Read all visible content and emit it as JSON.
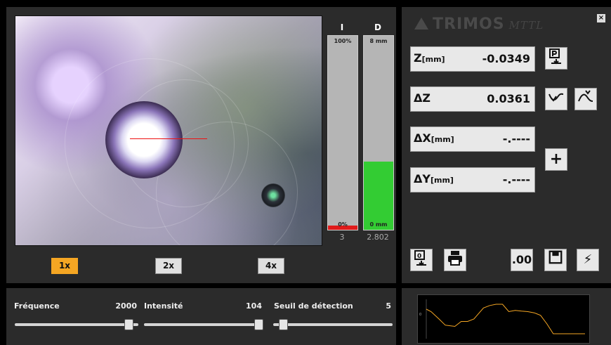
{
  "bars": {
    "intensity": {
      "label": "I",
      "top": "100%",
      "bottom": "0%",
      "value": "3",
      "fill_fraction": 0.02,
      "fill_color": "#e01b1b"
    },
    "distance": {
      "label": "D",
      "top": "8 mm",
      "bottom": "0 mm",
      "value": "2.802",
      "fill_fraction": 0.35,
      "fill_color": "#33cc33"
    }
  },
  "zoom": {
    "z1": "1x",
    "z2": "2x",
    "z4": "4x",
    "active": "1x",
    "active_color": "#f5a623"
  },
  "logo": {
    "name": "TRIMOS",
    "sub": "MTTL"
  },
  "close_label": "×",
  "fields": {
    "z": {
      "label": "Z",
      "unit": "[mm]",
      "value": "-0.0349"
    },
    "dz": {
      "label": "ΔZ",
      "value": "0.0361"
    },
    "dx": {
      "label": "ΔX",
      "unit": "[mm]",
      "value": "-.----"
    },
    "dy": {
      "label": "ΔY",
      "unit": "[mm]",
      "value": "-.----"
    }
  },
  "buttons": {
    "plus": "+",
    "zero": ".00",
    "flash": "⚡"
  },
  "sliders": {
    "frequency": {
      "label": "Fréquence",
      "value": "2000"
    },
    "intensity": {
      "label": "Intensité",
      "value": "104"
    },
    "threshold": {
      "label": "Seuil de détection",
      "value": "5"
    }
  },
  "chart_data": {
    "type": "line",
    "title": "",
    "xlabel": "",
    "ylabel": "",
    "ytick_labels": [
      "0"
    ],
    "series_color": "#f5a623",
    "x": [
      0,
      3,
      8,
      12,
      18,
      22,
      26,
      30,
      36,
      40,
      44,
      48,
      52,
      56,
      60,
      64,
      68,
      72,
      76,
      80,
      84,
      88,
      92,
      96,
      100
    ],
    "values": [
      0.2,
      0.1,
      -0.2,
      -0.45,
      -0.5,
      -0.3,
      -0.3,
      -0.2,
      0.25,
      0.35,
      0.4,
      0.4,
      0.1,
      0.15,
      0.12,
      0.1,
      0.05,
      -0.05,
      -0.4,
      -0.8,
      -0.8,
      -0.8,
      -0.8,
      -0.8,
      -0.8
    ]
  }
}
